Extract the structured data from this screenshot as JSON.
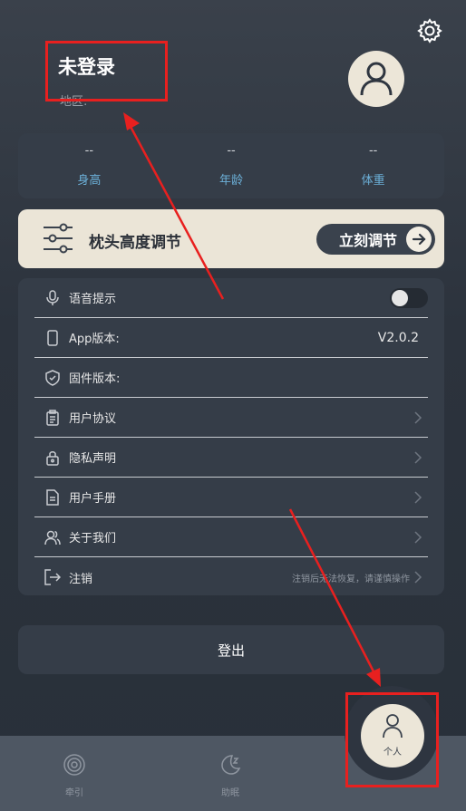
{
  "header": {
    "user_name": "未登录",
    "region_label": "地区:"
  },
  "stats": [
    {
      "value": "--",
      "label": "身高"
    },
    {
      "value": "--",
      "label": "年龄"
    },
    {
      "value": "--",
      "label": "体重"
    }
  ],
  "pillow": {
    "title": "枕头高度调节",
    "button_label": "立刻调节"
  },
  "settings": {
    "voice_label": "语音提示",
    "voice_enabled": false,
    "app_version_label": "App版本:",
    "app_version_value": "V2.0.2",
    "firmware_label": "固件版本:",
    "agreement_label": "用户协议",
    "privacy_label": "隐私声明",
    "manual_label": "用户手册",
    "about_label": "关于我们",
    "cancel_label": "注销",
    "cancel_note": "注销后无法恢复，请谨慎操作"
  },
  "logout_label": "登出",
  "tabs": {
    "tab1_label": "牵引",
    "tab2_label": "助眠",
    "tab3_label": "个人"
  },
  "colors": {
    "accent_blue": "#6cb0d8",
    "card_bg": "#353d48",
    "cream": "#ebe5d7",
    "annotation_red": "#e8201f"
  }
}
